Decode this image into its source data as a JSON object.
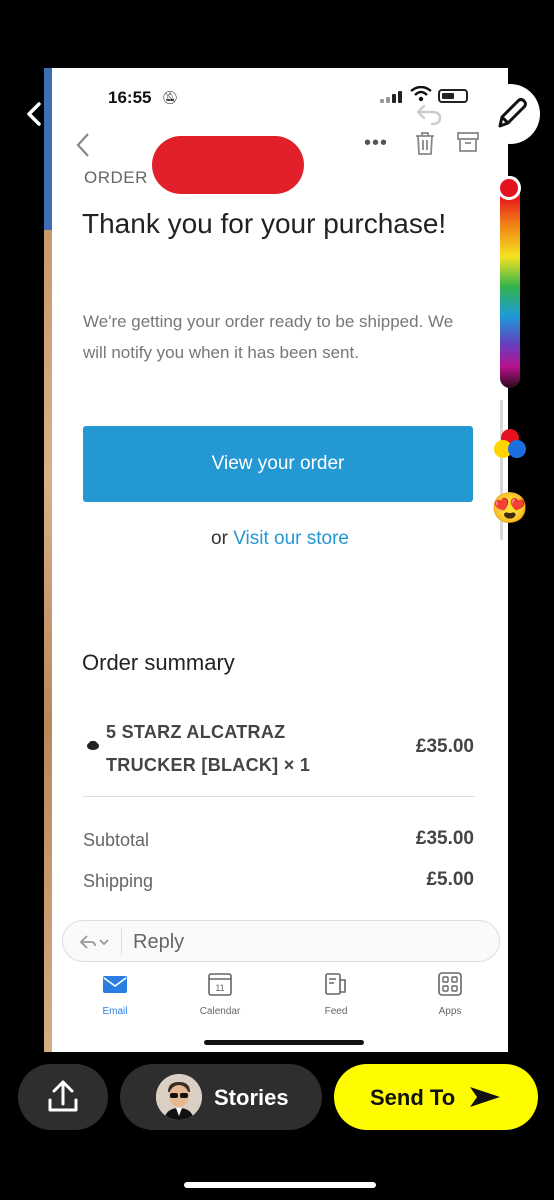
{
  "status_bar": {
    "time": "16:55"
  },
  "email": {
    "header_label": "ORDER",
    "title": "Thank you for your purchase!",
    "subtitle": "We're getting your order ready to be shipped. We will notify you when it has been sent.",
    "primary_button": "View your order",
    "or_text": "or",
    "store_link": "Visit our store"
  },
  "order_summary": {
    "title": "Order summary",
    "items": [
      {
        "name": "5 STARZ ALCATRAZ TRUCKER [BLACK] × 1",
        "price": "£35.00"
      }
    ],
    "subtotal_label": "Subtotal",
    "subtotal_value": "£35.00",
    "shipping_label": "Shipping",
    "shipping_value": "£5.00"
  },
  "reply": {
    "label": "Reply"
  },
  "tabs": [
    {
      "label": "Email",
      "icon": "envelope-icon",
      "active": true
    },
    {
      "label": "Calendar",
      "icon": "calendar-icon",
      "date": "11"
    },
    {
      "label": "Feed",
      "icon": "feed-icon"
    },
    {
      "label": "Apps",
      "icon": "apps-grid-icon"
    }
  ],
  "snap_bottom": {
    "stories_label": "Stories",
    "send_label": "Send To"
  },
  "colors": {
    "accent_blue": "#2398d3",
    "snap_yellow": "#fffc00",
    "redaction_red": "#e1202b"
  }
}
